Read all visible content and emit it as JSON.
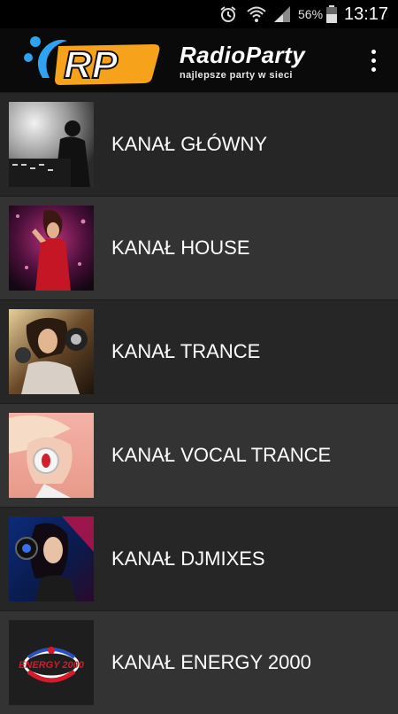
{
  "status_bar": {
    "battery_percent": "56%",
    "time": "13:17",
    "icons": [
      "alarm-icon",
      "wifi-icon",
      "signal-icon",
      "battery-icon"
    ]
  },
  "app_bar": {
    "logo_text": "RP",
    "title": "RadioParty",
    "tagline": "najlepsze party w sieci",
    "menu_icon": "more-vert-icon"
  },
  "channels": [
    {
      "label": "KANAŁ GŁÓWNY",
      "thumb": "dj-silhouette"
    },
    {
      "label": "KANAŁ HOUSE",
      "thumb": "house-party-girl"
    },
    {
      "label": "KANAŁ TRANCE",
      "thumb": "trance-headphones-girl"
    },
    {
      "label": "KANAŁ VOCAL TRANCE",
      "thumb": "vocal-trance-headphones"
    },
    {
      "label": "KANAŁ DJMIXES",
      "thumb": "djmixes-girl"
    },
    {
      "label": "KANAŁ ENERGY 2000",
      "thumb": "energy-2000-logo",
      "logo_text": "ENERGY 2000"
    }
  ],
  "colors": {
    "logo_orange": "#f7a21b",
    "logo_blue": "#2ea3f2",
    "row_dark": "#262626",
    "row_light": "#333333"
  }
}
